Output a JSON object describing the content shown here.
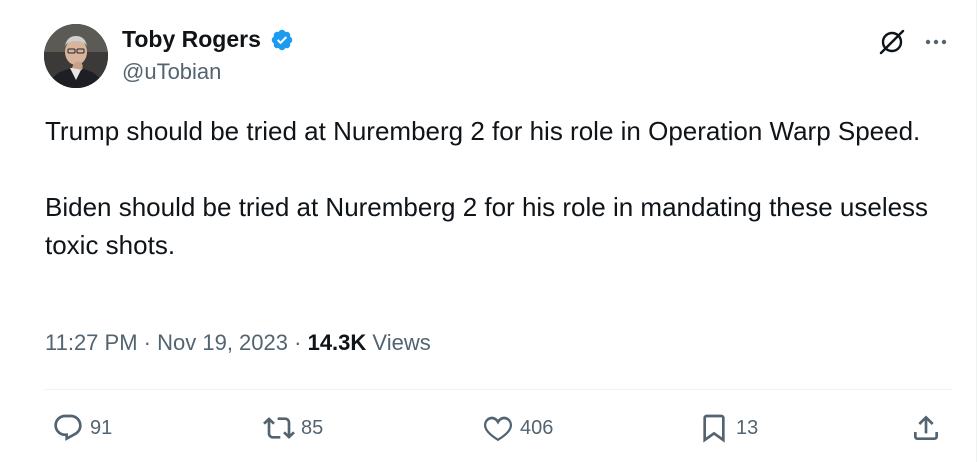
{
  "author": {
    "name": "Toby Rogers",
    "handle": "@uTobian",
    "verified": true
  },
  "tweet": {
    "paragraphs": [
      "Trump should be tried at Nuremberg 2 for his role in Operation Warp Speed.",
      "Biden should be tried at Nuremberg 2 for his role in mandating these useless toxic shots."
    ],
    "time": "11:27 PM",
    "date": "Nov 19, 2023",
    "separator": "·",
    "views_count": "14.3K",
    "views_label": "Views"
  },
  "actions": {
    "replies": "91",
    "reposts": "85",
    "likes": "406",
    "bookmarks": "13"
  },
  "icons": [
    "grok-icon",
    "more-icon",
    "reply-icon",
    "repost-icon",
    "like-icon",
    "bookmark-icon",
    "share-icon",
    "verified-badge-icon"
  ],
  "colors": {
    "text": "#0f1419",
    "secondary": "#536471",
    "verified": "#1d9bf0",
    "divider": "#eff3f4"
  }
}
